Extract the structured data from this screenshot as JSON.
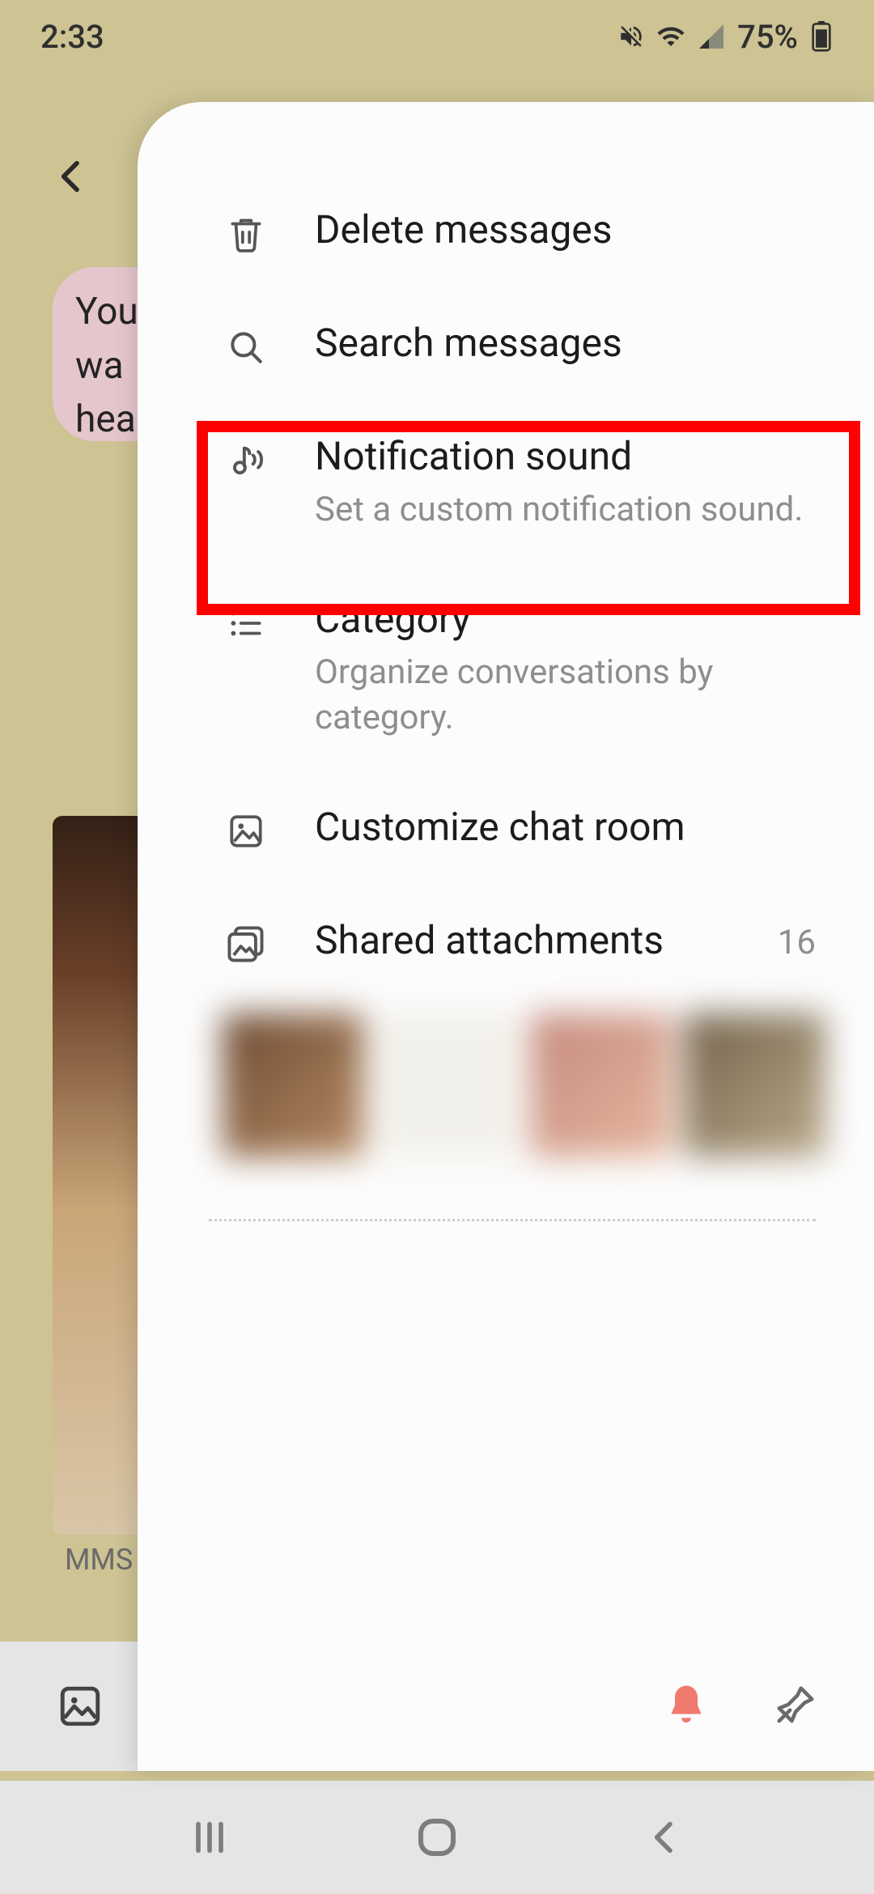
{
  "status": {
    "time": "2:33",
    "battery": "75%"
  },
  "chat_bg": {
    "bubble_text": "You\nwa\nhea",
    "mms_label": "MMS"
  },
  "menu": {
    "delete": {
      "title": "Delete messages"
    },
    "search": {
      "title": "Search messages"
    },
    "notification": {
      "title": "Notification sound",
      "sub": "Set a custom notification sound."
    },
    "category": {
      "title": "Category",
      "sub": "Organize conversations by category."
    },
    "customize": {
      "title": "Customize chat room"
    },
    "shared": {
      "title": "Shared attachments",
      "count": "16"
    }
  },
  "highlight": {
    "item": "notification-sound"
  }
}
